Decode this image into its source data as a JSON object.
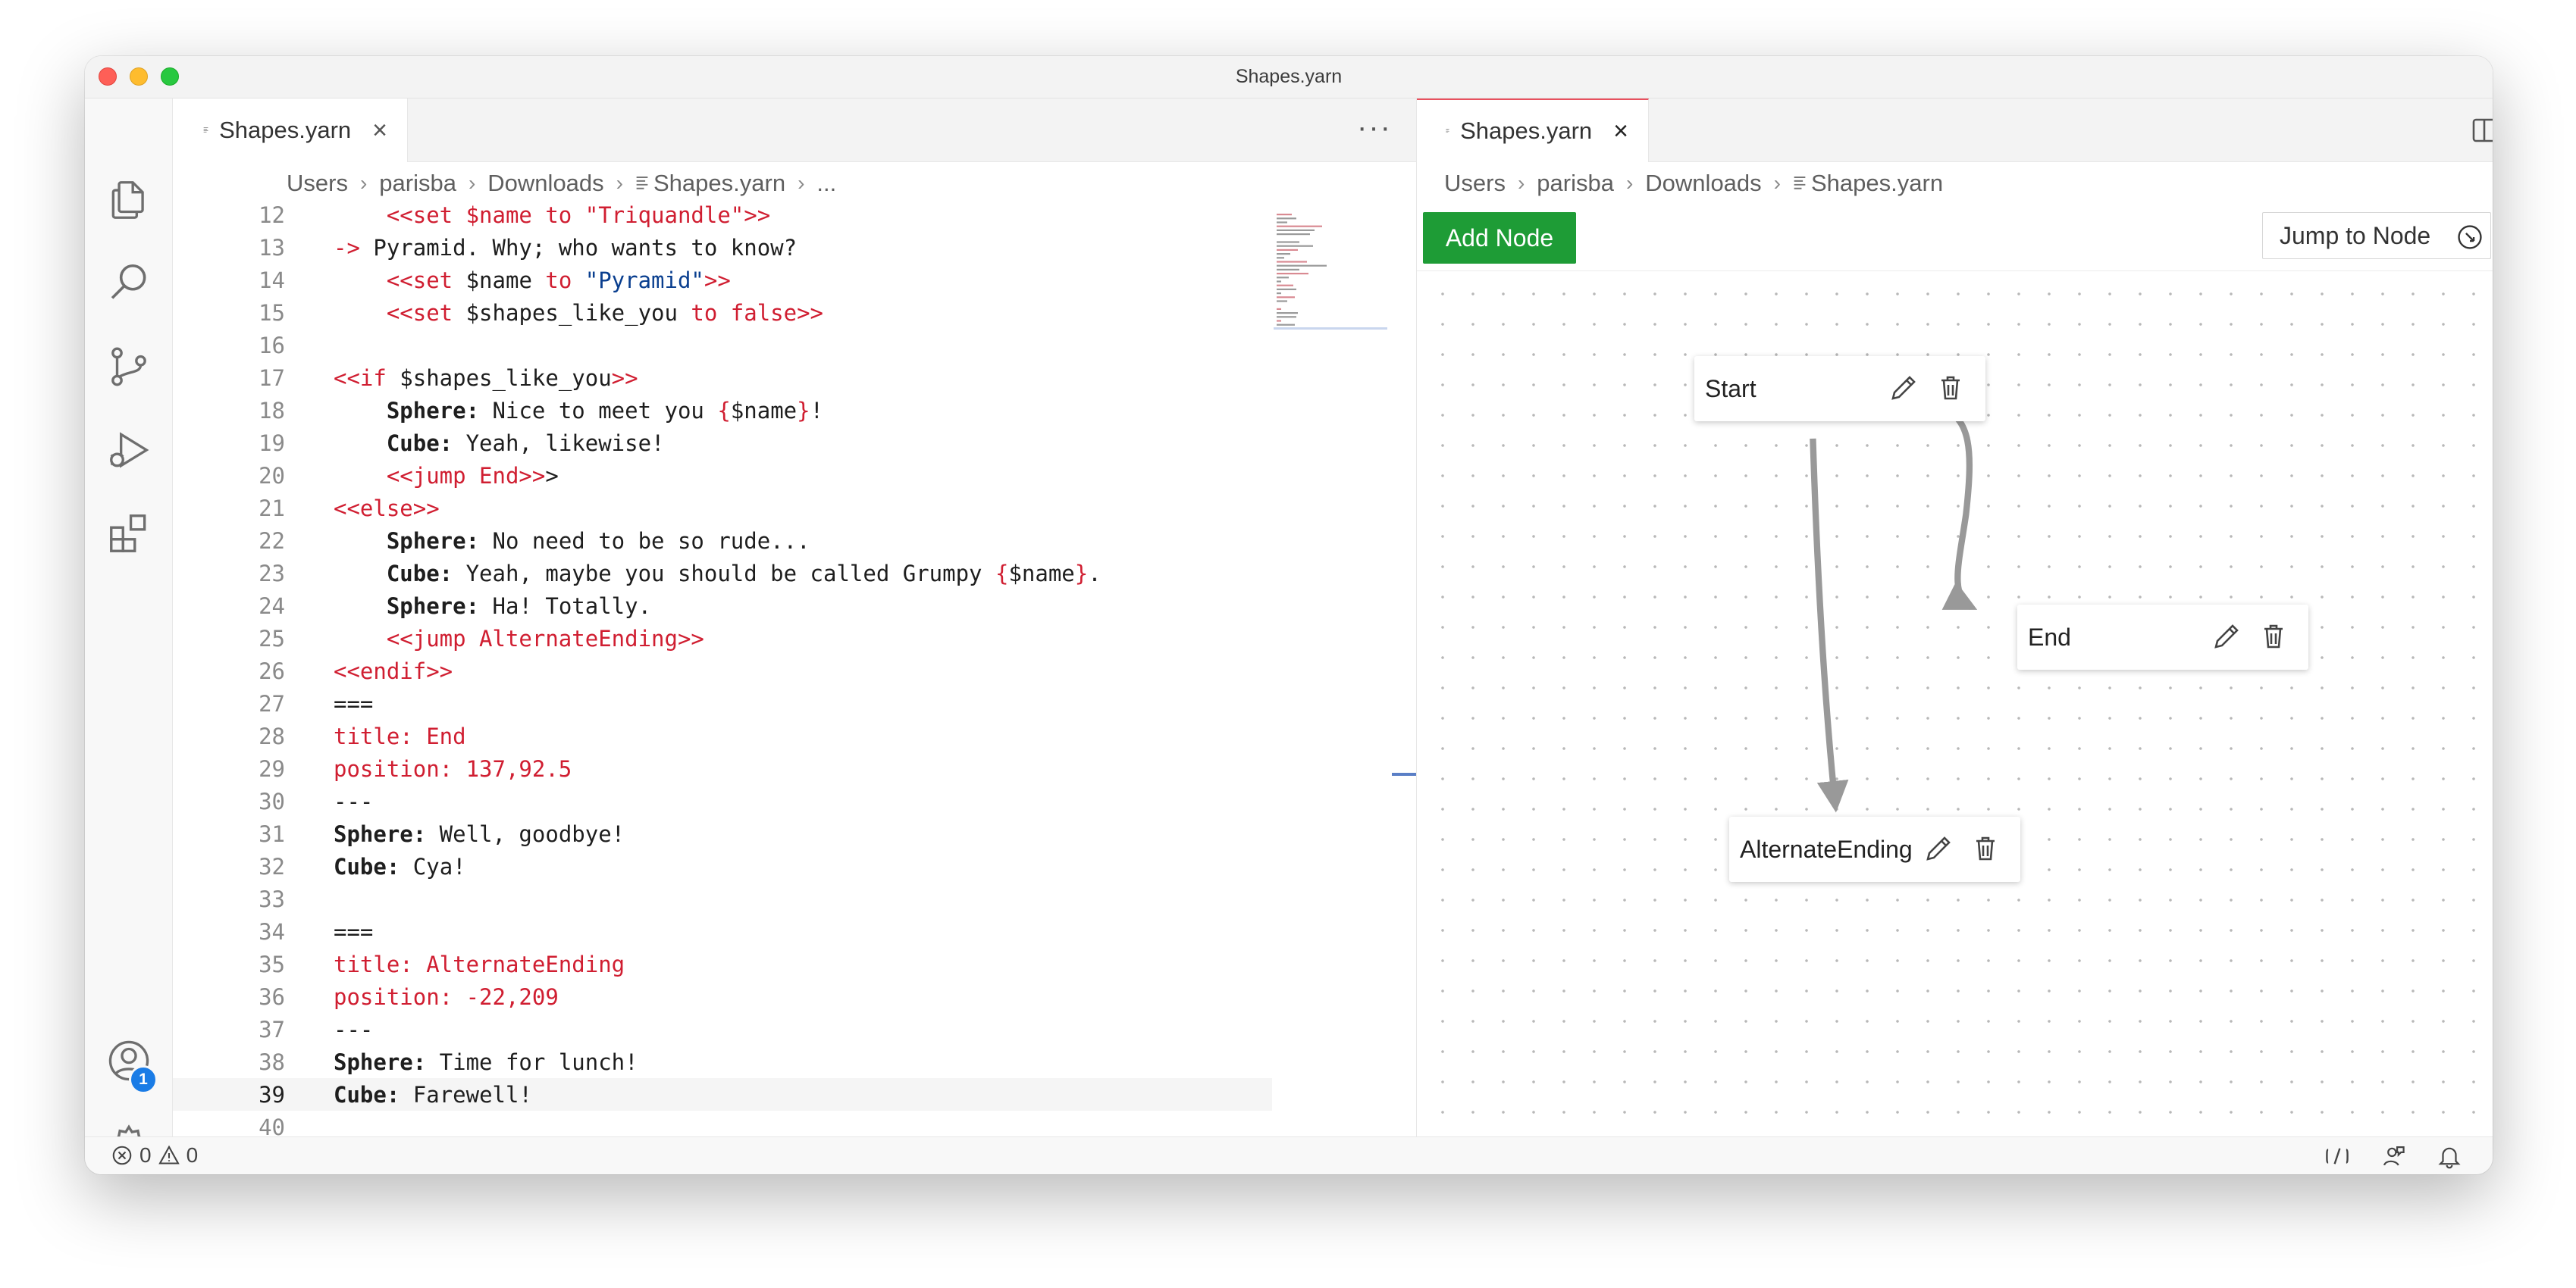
{
  "window": {
    "title": "Shapes.yarn"
  },
  "activity_bar": {
    "items": [
      "explorer-icon",
      "search-icon",
      "source-control-icon",
      "run-debug-icon",
      "extensions-icon"
    ],
    "account_badge": "1"
  },
  "left_editor": {
    "tab": {
      "label": "Shapes.yarn"
    },
    "more_label": "···",
    "breadcrumbs": [
      "Users",
      "parisba",
      "Downloads",
      "Shapes.yarn",
      "..."
    ],
    "lines": [
      {
        "n": "12",
        "tokens": [
          {
            "c": "k",
            "t": "    <<set $name to \"Triquandle\">>"
          }
        ]
      },
      {
        "n": "13",
        "tokens": [
          {
            "c": "k",
            "t": "->"
          },
          {
            "c": "",
            "t": " Pyramid. Why; who wants to know?"
          }
        ]
      },
      {
        "n": "14",
        "tokens": [
          {
            "c": "k",
            "t": "    <<set"
          },
          {
            "c": "",
            "t": " $name "
          },
          {
            "c": "k",
            "t": "to"
          },
          {
            "c": "",
            "t": " "
          },
          {
            "c": "s",
            "t": "\"Pyramid\""
          },
          {
            "c": "k",
            "t": ">>"
          }
        ]
      },
      {
        "n": "15",
        "tokens": [
          {
            "c": "k",
            "t": "    <<set"
          },
          {
            "c": "",
            "t": " $shapes_like_you "
          },
          {
            "c": "k",
            "t": "to false>>"
          }
        ]
      },
      {
        "n": "16",
        "tokens": []
      },
      {
        "n": "17",
        "tokens": [
          {
            "c": "k",
            "t": "<<if"
          },
          {
            "c": "",
            "t": " $shapes_like_you"
          },
          {
            "c": "k",
            "t": ">>"
          }
        ]
      },
      {
        "n": "18",
        "tokens": [
          {
            "c": "b",
            "t": "    Sphere:"
          },
          {
            "c": "",
            "t": " Nice to meet you "
          },
          {
            "c": "k",
            "t": "{"
          },
          {
            "c": "",
            "t": "$name"
          },
          {
            "c": "k",
            "t": "}"
          },
          {
            "c": "",
            "t": "!"
          }
        ]
      },
      {
        "n": "19",
        "tokens": [
          {
            "c": "b",
            "t": "    Cube:"
          },
          {
            "c": "",
            "t": " Yeah, likewise!"
          }
        ]
      },
      {
        "n": "20",
        "tokens": [
          {
            "c": "k",
            "t": "    <<jump End>>"
          },
          {
            "c": "",
            "t": ">"
          }
        ]
      },
      {
        "n": "21",
        "tokens": [
          {
            "c": "k",
            "t": "<<else>>"
          }
        ]
      },
      {
        "n": "22",
        "tokens": [
          {
            "c": "b",
            "t": "    Sphere:"
          },
          {
            "c": "",
            "t": " No need to be so rude..."
          }
        ]
      },
      {
        "n": "23",
        "tokens": [
          {
            "c": "b",
            "t": "    Cube:"
          },
          {
            "c": "",
            "t": " Yeah, maybe you should be called Grumpy "
          },
          {
            "c": "k",
            "t": "{"
          },
          {
            "c": "",
            "t": "$name"
          },
          {
            "c": "k",
            "t": "}"
          },
          {
            "c": "",
            "t": "."
          }
        ]
      },
      {
        "n": "24",
        "tokens": [
          {
            "c": "b",
            "t": "    Sphere:"
          },
          {
            "c": "",
            "t": " Ha! Totally."
          }
        ]
      },
      {
        "n": "25",
        "tokens": [
          {
            "c": "k",
            "t": "    <<jump AlternateEnding>>"
          }
        ]
      },
      {
        "n": "26",
        "tokens": [
          {
            "c": "k",
            "t": "<<endif>>"
          }
        ]
      },
      {
        "n": "27",
        "tokens": [
          {
            "c": "",
            "t": "==="
          }
        ]
      },
      {
        "n": "28",
        "tokens": [
          {
            "c": "k",
            "t": "title: End"
          }
        ]
      },
      {
        "n": "29",
        "tokens": [
          {
            "c": "k",
            "t": "position: 137,92.5"
          }
        ]
      },
      {
        "n": "30",
        "tokens": [
          {
            "c": "",
            "t": "---"
          }
        ]
      },
      {
        "n": "31",
        "tokens": [
          {
            "c": "b",
            "t": "Sphere:"
          },
          {
            "c": "",
            "t": " Well, goodbye!"
          }
        ]
      },
      {
        "n": "32",
        "tokens": [
          {
            "c": "b",
            "t": "Cube:"
          },
          {
            "c": "",
            "t": " Cya!"
          }
        ]
      },
      {
        "n": "33",
        "tokens": []
      },
      {
        "n": "34",
        "tokens": [
          {
            "c": "",
            "t": "==="
          }
        ]
      },
      {
        "n": "35",
        "tokens": [
          {
            "c": "k",
            "t": "title: AlternateEnding"
          }
        ]
      },
      {
        "n": "36",
        "tokens": [
          {
            "c": "k",
            "t": "position: -22,209"
          }
        ]
      },
      {
        "n": "37",
        "tokens": [
          {
            "c": "",
            "t": "---"
          }
        ]
      },
      {
        "n": "38",
        "tokens": [
          {
            "c": "b",
            "t": "Sphere:"
          },
          {
            "c": "",
            "t": " Time for lunch!"
          }
        ]
      },
      {
        "n": "39",
        "tokens": [
          {
            "c": "b",
            "t": "Cube:"
          },
          {
            "c": "",
            "t": " Farewell!"
          }
        ],
        "current": true
      },
      {
        "n": "40",
        "tokens": []
      }
    ]
  },
  "right_editor": {
    "tab": {
      "label": "Shapes.yarn"
    },
    "more_label": "···",
    "breadcrumbs": [
      "Users",
      "parisba",
      "Downloads",
      "Shapes.yarn"
    ],
    "add_node_label": "Add Node",
    "jump_to_node_label": "Jump to Node",
    "nodes": [
      {
        "id": "start",
        "title": "Start"
      },
      {
        "id": "end",
        "title": "End"
      },
      {
        "id": "alternate",
        "title": "AlternateEnding"
      }
    ]
  },
  "status_bar": {
    "errors": "0",
    "warnings": "0"
  },
  "colors": {
    "accent_green": "#1e9c36",
    "keyword_red": "#d01e31",
    "string_blue": "#0a3f8f",
    "badge_blue": "#1a7ce6"
  }
}
